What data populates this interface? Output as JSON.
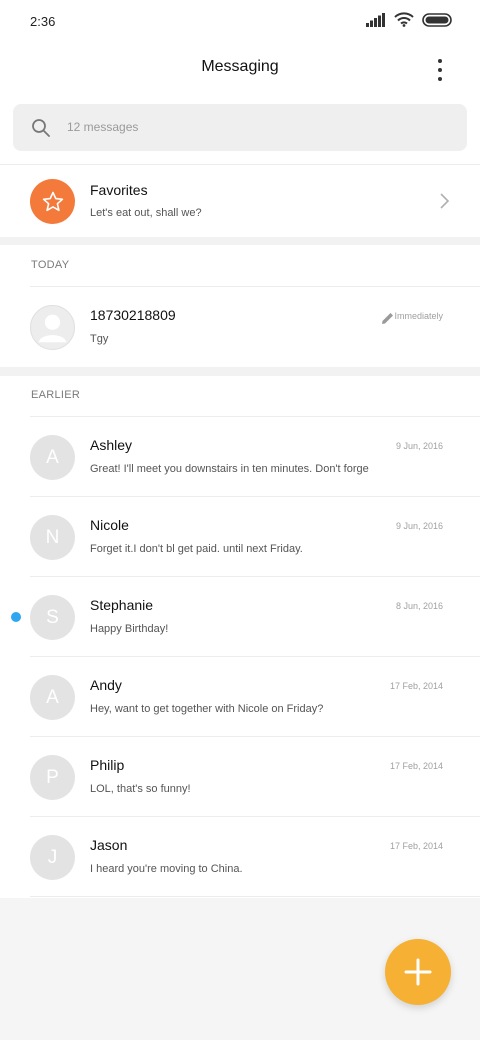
{
  "status_bar": {
    "time": "2:36"
  },
  "header": {
    "title": "Messaging"
  },
  "search": {
    "placeholder": "12 messages"
  },
  "favorites": {
    "title": "Favorites",
    "preview": "Let's eat out, shall we?",
    "accent": "#f37a3b"
  },
  "sections": {
    "today": "TODAY",
    "earlier": "EARLIER"
  },
  "today": [
    {
      "name": "18730218809",
      "preview": "Tgy",
      "time": "Immediately"
    }
  ],
  "earlier": [
    {
      "initial": "A",
      "name": "Ashley",
      "preview": "Great! I'll meet you downstairs in ten minutes. Don't forge",
      "date": "9 Jun, 2016",
      "unread": false
    },
    {
      "initial": "N",
      "name": "Nicole",
      "preview": "Forget it.I don't bl get paid. until next Friday.",
      "date": "9 Jun, 2016",
      "unread": false
    },
    {
      "initial": "S",
      "name": "Stephanie",
      "preview": "Happy Birthday!",
      "date": "8 Jun, 2016",
      "unread": true
    },
    {
      "initial": "A",
      "name": "Andy",
      "preview": "Hey, want to get together with Nicole on Friday?",
      "date": "17 Feb, 2014",
      "unread": false
    },
    {
      "initial": "P",
      "name": "Philip",
      "preview": "LOL, that's so funny!",
      "date": "17 Feb, 2014",
      "unread": false
    },
    {
      "initial": "J",
      "name": "Jason",
      "preview": "I heard you're moving to China.",
      "date": "17 Feb, 2014",
      "unread": false
    }
  ],
  "colors": {
    "fab": "#f6b034",
    "unread_dot": "#2ea7ee",
    "avatar": "#e3e3e3"
  },
  "icons": {
    "status": [
      "signal-icon",
      "wifi-icon",
      "battery-icon"
    ],
    "menu": "more-vert-icon",
    "search": "search-icon",
    "favorites": "star-icon",
    "chevron": "chevron-right-icon",
    "contact": "person-icon",
    "edit": "pencil-icon",
    "fab": "plus-icon"
  }
}
